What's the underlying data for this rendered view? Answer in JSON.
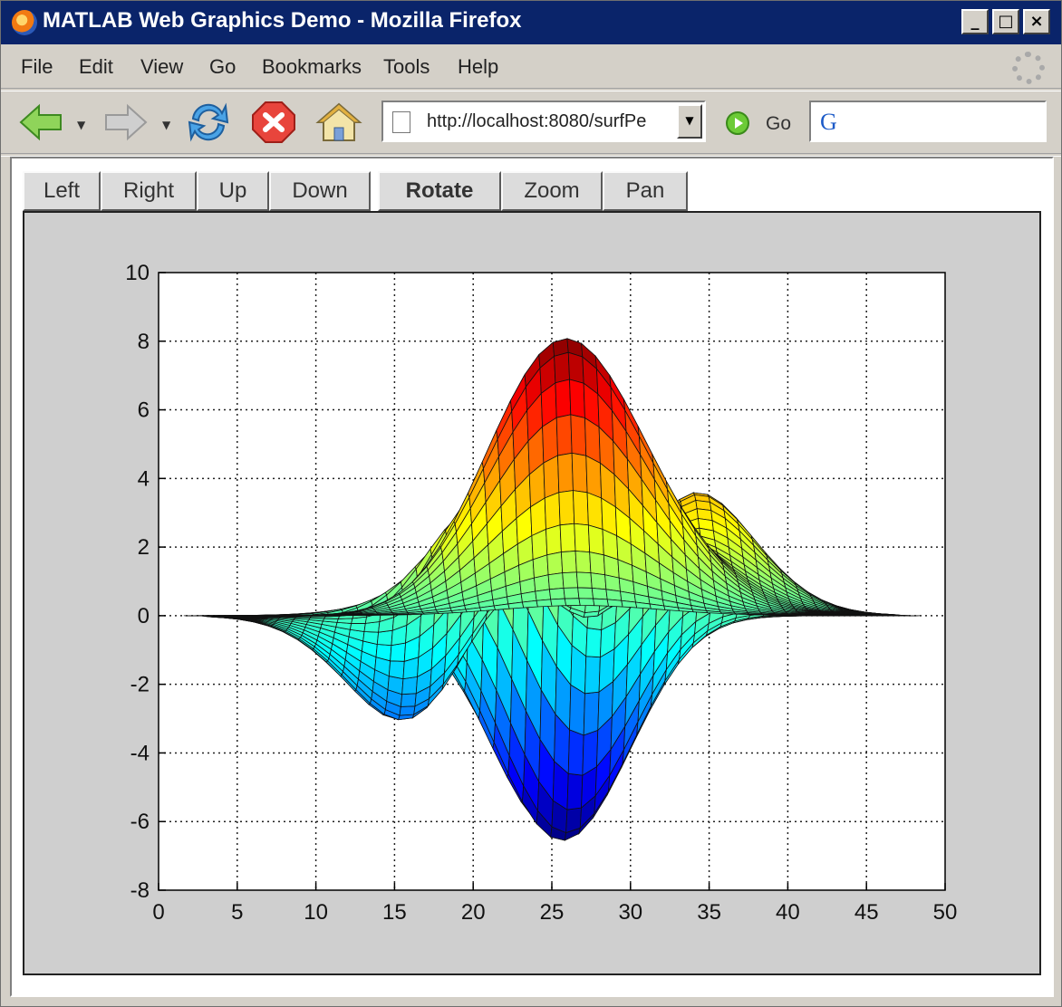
{
  "window": {
    "title": "MATLAB Web Graphics Demo - Mozilla Firefox",
    "minimize": "_",
    "maximize": "□",
    "close": "×"
  },
  "menu": {
    "items": [
      {
        "label": "File"
      },
      {
        "label": "Edit"
      },
      {
        "label": "View"
      },
      {
        "label": "Go"
      },
      {
        "label": "Bookmarks"
      },
      {
        "label": "Tools"
      },
      {
        "label": "Help"
      }
    ]
  },
  "toolbar": {
    "address": "http://localhost:8080/surfPe",
    "go_label": "Go",
    "search_logo": "G"
  },
  "controls": {
    "buttons": [
      {
        "label": "Left"
      },
      {
        "label": "Right"
      },
      {
        "label": "Up"
      },
      {
        "label": "Down"
      },
      {
        "label": "Rotate"
      },
      {
        "label": "Zoom"
      },
      {
        "label": "Pan"
      }
    ],
    "active": "Rotate"
  },
  "chart_data": {
    "type": "surface",
    "title": "",
    "xlabel": "",
    "ylabel": "",
    "xlim": [
      0,
      50
    ],
    "ylim": [
      -8,
      10
    ],
    "xticks": [
      0,
      5,
      10,
      15,
      20,
      25,
      30,
      35,
      40,
      45,
      50
    ],
    "yticks": [
      -8,
      -6,
      -4,
      -2,
      0,
      2,
      4,
      6,
      8,
      10
    ],
    "grid": true,
    "colormap": "jet",
    "features": [
      {
        "x": 25,
        "y": 8.1
      },
      {
        "x": 27,
        "y": -6.5
      },
      {
        "x": 35.5,
        "y": 3.6
      },
      {
        "x": 14,
        "y": -3.0
      },
      {
        "x": 21,
        "y": 3.8
      }
    ]
  }
}
